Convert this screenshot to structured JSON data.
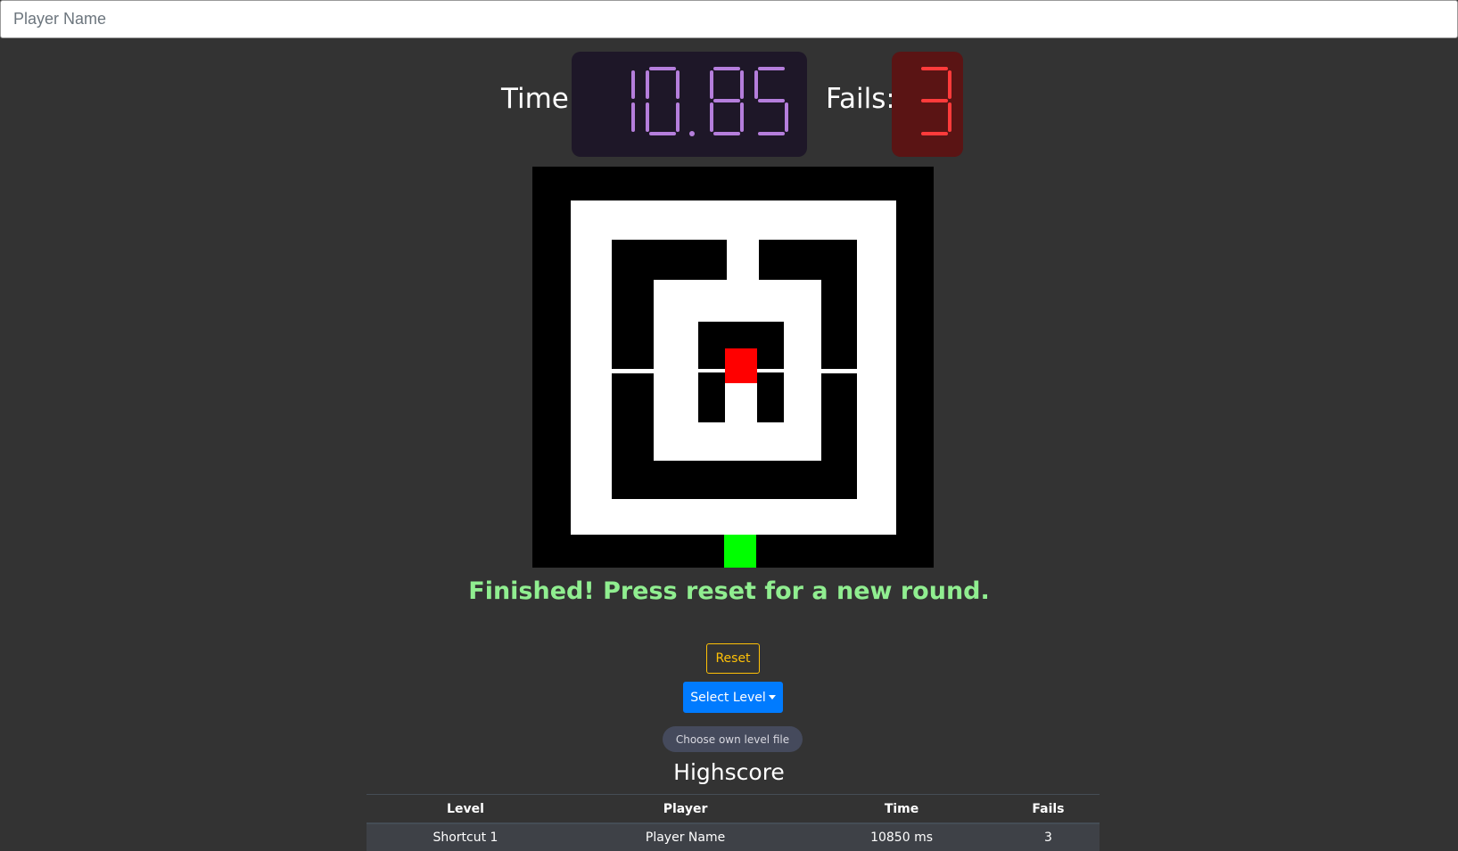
{
  "player": {
    "placeholder": "Player Name",
    "value": ""
  },
  "timer": {
    "label": "Time:",
    "value": "10.85",
    "digit_color": "#b57edc",
    "background": "#1e1728"
  },
  "fails": {
    "label": "Fails:",
    "value": "3",
    "digit_color": "#ff3b3b",
    "background": "#5a1414"
  },
  "maze": {
    "wall_color": "#000000",
    "path_color": "#ffffff",
    "player_color": "#ff0000",
    "goal_color": "#00ff00"
  },
  "status": {
    "message": "Finished! Press reset for a new round."
  },
  "controls": {
    "reset_label": "Reset",
    "select_level_label": "Select Level",
    "choose_file_label": "Choose own level file"
  },
  "highscore": {
    "title": "Highscore",
    "columns": [
      "Level",
      "Player",
      "Time",
      "Fails"
    ],
    "rows": [
      [
        "Shortcut 1",
        "Player Name",
        "10850 ms",
        "3"
      ]
    ]
  }
}
